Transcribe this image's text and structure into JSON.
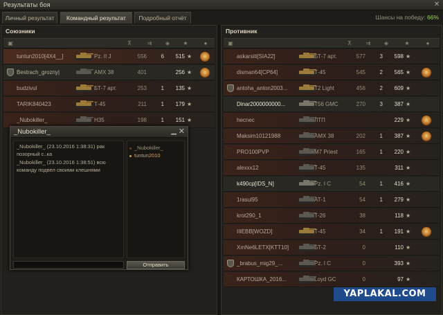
{
  "window": {
    "title": "Результаты боя"
  },
  "tabs": [
    {
      "label": "Личный результат",
      "active": false
    },
    {
      "label": "Командный результат",
      "active": true
    },
    {
      "label": "Подробный отчёт",
      "active": false
    }
  ],
  "win_chance": {
    "label": "Шансы на победу:",
    "value": "66%"
  },
  "allies": {
    "title": "Союзники",
    "rows": [
      {
        "nick": "tuntun2010[4X4__]",
        "vehicle": "Pz. II J",
        "v1": "556",
        "kills": "6",
        "xp": "515",
        "medal": true,
        "style": "self",
        "icon": "",
        "tank_color": "#9c7a3a"
      },
      {
        "nick": "Bestrach_grozny|",
        "vehicle": "AMX 38",
        "v1": "401",
        "kills": "",
        "xp": "256",
        "medal": true,
        "style": "alt",
        "icon": "platoon-icon",
        "tank_color": "#5a5850"
      },
      {
        "nick": "budzivul",
        "vehicle": "БТ-7 арт.",
        "v1": "253",
        "kills": "1",
        "xp": "135",
        "medal": false,
        "style": "dead",
        "icon": "",
        "tank_color": "#9c7a3a"
      },
      {
        "nick": "TARIK840423",
        "vehicle": "Т-45",
        "v1": "211",
        "kills": "1",
        "xp": "179",
        "medal": false,
        "style": "dead",
        "icon": "",
        "tank_color": "#9c7a3a"
      },
      {
        "nick": "_Nubokiller_",
        "vehicle": "H35",
        "v1": "198",
        "kills": "1",
        "xp": "151",
        "medal": false,
        "style": "dead",
        "icon": "",
        "tank_color": "#5a5850"
      }
    ]
  },
  "enemies": {
    "title": "Противник",
    "rows": [
      {
        "nick": "askarsiti[SIA22]",
        "vehicle": "БТ-7 арт.",
        "v1": "577",
        "kills": "3",
        "xp": "598",
        "medal": false,
        "style": "dead",
        "icon": "",
        "tank_color": "#9c7a3a"
      },
      {
        "nick": "disman64[CP64]",
        "vehicle": "Т-45",
        "v1": "545",
        "kills": "2",
        "xp": "565",
        "medal": true,
        "style": "dead",
        "icon": "",
        "tank_color": "#9c7a3a"
      },
      {
        "nick": "antoha_anton2003...",
        "vehicle": "T2 Light",
        "v1": "456",
        "kills": "2",
        "xp": "609",
        "medal": false,
        "style": "dead",
        "icon": "platoon-icon",
        "tank_color": "#9c7a3a"
      },
      {
        "nick": "Dinar2000000000...",
        "vehicle": "T56 GMC",
        "v1": "270",
        "kills": "3",
        "xp": "387",
        "medal": false,
        "style": "alt",
        "icon": "",
        "tank_color": "#7a766a",
        "bright": true
      },
      {
        "nick": "hecnec",
        "vehicle": "ЛТП",
        "v1": "",
        "kills": "",
        "xp": "229",
        "medal": true,
        "style": "dead",
        "icon": "",
        "tank_color": "#5a5850"
      },
      {
        "nick": "Maksim10121988",
        "vehicle": "AMX 38",
        "v1": "202",
        "kills": "1",
        "xp": "387",
        "medal": true,
        "style": "dead",
        "icon": "",
        "tank_color": "#5a5850"
      },
      {
        "nick": "PRO100PVP",
        "vehicle": "M7 Priest",
        "v1": "165",
        "kills": "1",
        "xp": "220",
        "medal": false,
        "style": "dead",
        "icon": "",
        "tank_color": "#5a5850"
      },
      {
        "nick": "alexxx12",
        "vehicle": "Т-45",
        "v1": "135",
        "kills": "",
        "xp": "311",
        "medal": false,
        "style": "dead",
        "icon": "",
        "tank_color": "#5a5850"
      },
      {
        "nick": "k490cp[IDS_N]",
        "vehicle": "Pz. I C",
        "v1": "54",
        "kills": "1",
        "xp": "416",
        "medal": false,
        "style": "alt",
        "icon": "",
        "tank_color": "#7a766a",
        "bright": true
      },
      {
        "nick": "1rasul95",
        "vehicle": "АТ-1",
        "v1": "54",
        "kills": "1",
        "xp": "279",
        "medal": false,
        "style": "dead",
        "icon": "",
        "tank_color": "#5a5850"
      },
      {
        "nick": "krot290_1",
        "vehicle": "Т-26",
        "v1": "38",
        "kills": "",
        "xp": "118",
        "medal": false,
        "style": "dead",
        "icon": "",
        "tank_color": "#5a5850"
      },
      {
        "nick": "IIIEBB[WOZD]",
        "vehicle": "Т-45",
        "v1": "34",
        "kills": "1",
        "xp": "191",
        "medal": true,
        "style": "dead",
        "icon": "",
        "tank_color": "#9c7a3a"
      },
      {
        "nick": "XmNe6LETX[KTT10]",
        "vehicle": "БТ-2",
        "v1": "0",
        "kills": "",
        "xp": "110",
        "medal": false,
        "style": "dead",
        "icon": "",
        "tank_color": "#5a5850"
      },
      {
        "nick": "_brabus_mig29_...",
        "vehicle": "Pz. I C",
        "v1": "0",
        "kills": "",
        "xp": "393",
        "medal": false,
        "style": "dead",
        "icon": "platoon-icon",
        "tank_color": "#5a5850"
      },
      {
        "nick": "КАРТОШКА_2016...",
        "vehicle": "Loyd GC",
        "v1": "0",
        "kills": "",
        "xp": "97",
        "medal": false,
        "style": "dead",
        "icon": "",
        "tank_color": "#5a5850"
      }
    ]
  },
  "chat": {
    "title": "_Nubokiller_",
    "messages": [
      "_Nubokiller_ (23.10.2016 1:38:31) рак позорный с..ка",
      "_Nubokiller_ (23.10.2016 1:38:51) всю команду подвел своими клешнями"
    ],
    "members": [
      {
        "name": "_Nubokiller_",
        "online": false
      },
      {
        "name": "tuntun2010",
        "online": true
      }
    ],
    "input_value": "",
    "send_label": "Отправить"
  },
  "watermark": "YAPLAKAL.COM",
  "colors": {
    "accent_green": "#9ad34a",
    "row_dead": "#3b231b",
    "medal": "#e09a3c"
  }
}
